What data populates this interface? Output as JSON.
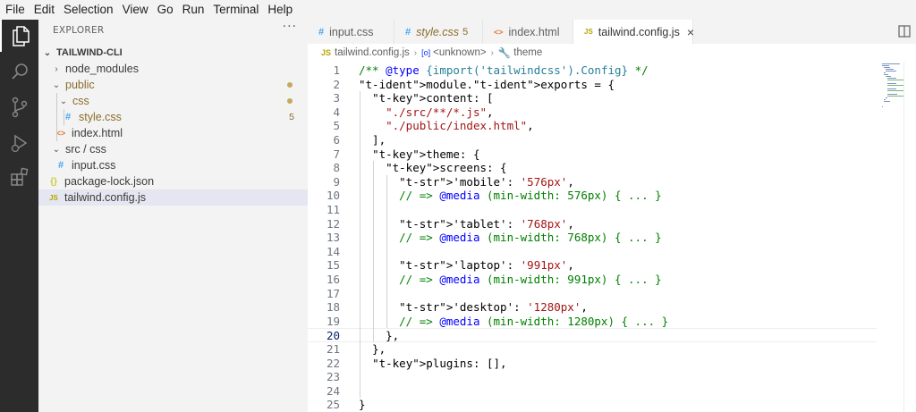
{
  "menubar": {
    "items": [
      "File",
      "Edit",
      "Selection",
      "View",
      "Go",
      "Run",
      "Terminal",
      "Help"
    ]
  },
  "activitybar": {
    "items": [
      {
        "icon": "files-icon",
        "active": true
      },
      {
        "icon": "search-icon",
        "active": false
      },
      {
        "icon": "source-control-icon",
        "active": false
      },
      {
        "icon": "run-debug-icon",
        "active": false
      },
      {
        "icon": "extensions-icon",
        "active": false
      }
    ]
  },
  "sidebar": {
    "title": "EXPLORER",
    "more": "···",
    "root": "TAILWIND-CLI",
    "items": [
      {
        "name": "node_modules",
        "type": "folder",
        "open": false
      },
      {
        "name": "public",
        "type": "folder",
        "open": true,
        "color": "#8a6d2b"
      },
      {
        "name": "css",
        "type": "folder",
        "open": true,
        "color": "#8a6d2b"
      },
      {
        "name": "style.css",
        "type": "css",
        "badge": "5",
        "color": "#8a6d2b",
        "icon": "#"
      },
      {
        "name": "index.html",
        "type": "html",
        "icon": "<>"
      },
      {
        "name": "src / css",
        "type": "folder",
        "open": true
      },
      {
        "name": "input.css",
        "type": "css",
        "icon": "#"
      },
      {
        "name": "package-lock.json",
        "type": "json",
        "icon": "{}"
      },
      {
        "name": "tailwind.config.js",
        "type": "js",
        "icon": "JS"
      }
    ]
  },
  "tabs": [
    {
      "name": "input.css",
      "icon": "#"
    },
    {
      "name": "style.css",
      "icon": "#",
      "modified": true,
      "badge": "5"
    },
    {
      "name": "index.html",
      "icon": "<>"
    },
    {
      "name": "tailwind.config.js",
      "icon": "JS",
      "active": true,
      "close": "×"
    }
  ],
  "breadcrumb": {
    "file_icon": "JS",
    "file": "tailwind.config.js",
    "unknown": "<unknown>",
    "symbol": "theme"
  },
  "editor": {
    "current_line": 20,
    "lines": [
      {
        "n": "1",
        "text": "/** @type {import('tailwindcss').Config} */"
      },
      {
        "n": "2",
        "text": "module.exports = {"
      },
      {
        "n": "3",
        "text": "  content: ["
      },
      {
        "n": "4",
        "text": "    \"./src/**/*.js\","
      },
      {
        "n": "5",
        "text": "    \"./public/index.html\","
      },
      {
        "n": "6",
        "text": "  ],"
      },
      {
        "n": "7",
        "text": "  theme: {"
      },
      {
        "n": "8",
        "text": "    screens: {"
      },
      {
        "n": "9",
        "text": "      'mobile': '576px',"
      },
      {
        "n": "10",
        "text": "      // => @media (min-width: 576px) { ... }"
      },
      {
        "n": "11",
        "text": ""
      },
      {
        "n": "12",
        "text": "      'tablet': '768px',"
      },
      {
        "n": "13",
        "text": "      // => @media (min-width: 768px) { ... }"
      },
      {
        "n": "14",
        "text": ""
      },
      {
        "n": "15",
        "text": "      'laptop': '991px',"
      },
      {
        "n": "16",
        "text": "      // => @media (min-width: 991px) { ... }"
      },
      {
        "n": "17",
        "text": ""
      },
      {
        "n": "18",
        "text": "      'desktop': '1280px',"
      },
      {
        "n": "19",
        "text": "      // => @media (min-width: 1280px) { ... }"
      },
      {
        "n": "20",
        "text": "    },"
      },
      {
        "n": "21",
        "text": "  },"
      },
      {
        "n": "22",
        "text": "  plugins: [],"
      },
      {
        "n": "23",
        "text": ""
      },
      {
        "n": "24",
        "text": ""
      },
      {
        "n": "25",
        "text": "}"
      }
    ]
  },
  "colors": {
    "activitybar_bg": "#2c2c2c",
    "sidebar_bg": "#f3f3f3",
    "selection_bg": "#e4e6f1",
    "modified_color": "#8a6d2b",
    "js_icon": "#cbcb41",
    "css_icon": "#42a5f5",
    "html_icon": "#e37933"
  }
}
